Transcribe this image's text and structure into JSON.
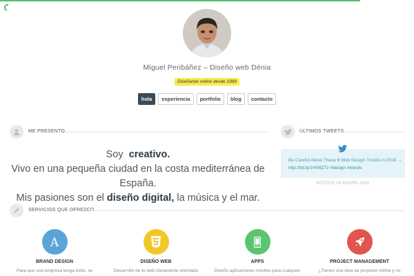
{
  "progress": {
    "fraction": 0.87,
    "color": "#4cc46a"
  },
  "profile": {
    "name": "Miguel Peribáñez – Diseño web Dénia",
    "tagline": "Diseñando online desde 1999"
  },
  "nav": {
    "items": [
      {
        "label": "hola",
        "active": true
      },
      {
        "label": "experiencia",
        "active": false
      },
      {
        "label": "portfolio",
        "active": false
      },
      {
        "label": "blog",
        "active": false
      },
      {
        "label": "contacto",
        "active": false
      }
    ]
  },
  "about": {
    "heading": "ME PRESENTO",
    "icon": "user-icon",
    "line1_prefix": "Soy",
    "line1_strong": "creativo.",
    "line2": "Vivo en una pequeña ciudad en la costa mediterránea de España.",
    "line3_prefix": "Mis pasiones son el",
    "line3_strong": "diseño digital,",
    "line3_suffix": "la música y el mar."
  },
  "tweets": {
    "heading": "ÚLTIMOS TWEETS",
    "icon": "twitter-icon",
    "text": "Be Careful About These 6 Web Design Trends in 2016 →",
    "link": "http://bit.ly/1HS6Z7z",
    "hashtags": "#design #trends",
    "posted": "POSTED 16 HOURS AGO"
  },
  "services": {
    "heading": "SERVICIOS QUE OFREZCO",
    "icon": "pencil-icon",
    "items": [
      {
        "title": "BRAND DESIGN",
        "desc": "Para que una empresa tenga éxito, se",
        "color": "#5aa5d8",
        "icon": "letter-a-icon"
      },
      {
        "title": "DISEÑO WEB",
        "desc": "Desarrollo de tu web claramente orientado",
        "color": "#f3c728",
        "icon": "html5-icon"
      },
      {
        "title": "APPS",
        "desc": "Diseño aplicaciones móviles para cualquier",
        "color": "#5cc46e",
        "icon": "mobile-icon"
      },
      {
        "title": "PROJECT MANAGEMENT",
        "desc": "¿Tienes una idea de proyecto online y no",
        "color": "#e0554e",
        "icon": "rocket-icon"
      }
    ]
  }
}
